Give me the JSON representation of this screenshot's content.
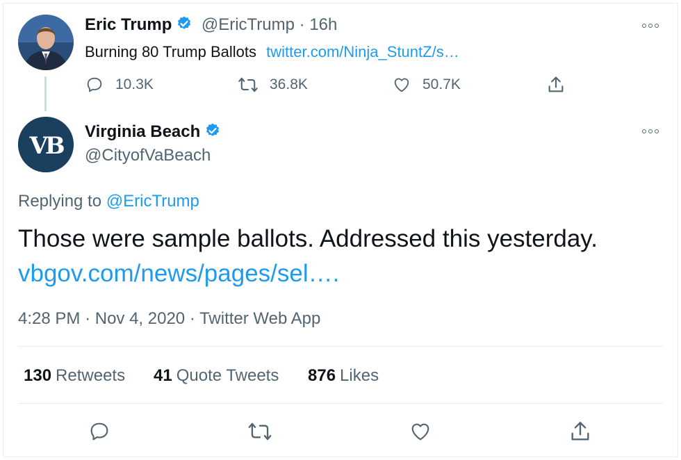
{
  "quoted_tweet": {
    "author_name": "Eric Trump",
    "author_handle": "@EricTrump",
    "separator": " · ",
    "time_ago": "16h",
    "text": "Burning 80 Trump Ballots",
    "link_text": "twitter.com/Ninja_StuntZ/s…",
    "replies": "10.3K",
    "retweets": "36.8K",
    "likes": "50.7K"
  },
  "main_tweet": {
    "author_name": "Virginia Beach",
    "author_handle": "@CityofVaBeach",
    "avatar_text": "VB",
    "replying_label": "Replying to",
    "replying_handle": "@EricTrump",
    "text": "Those were sample ballots. Addressed this yesterday.",
    "link_text": "vbgov.com/news/pages/sel….",
    "time": "4:28 PM",
    "date": "Nov 4, 2020",
    "source": "Twitter Web App",
    "dot": "·"
  },
  "stats": {
    "retweets_count": "130",
    "retweets_label": "Retweets",
    "quote_count": "41",
    "quote_label": "Quote Tweets",
    "likes_count": "876",
    "likes_label": "Likes"
  },
  "colors": {
    "link": "#1d9bf0",
    "muted": "#536471",
    "vb_avatar": "#1b3f5f",
    "verified": "#1d9bf0"
  }
}
